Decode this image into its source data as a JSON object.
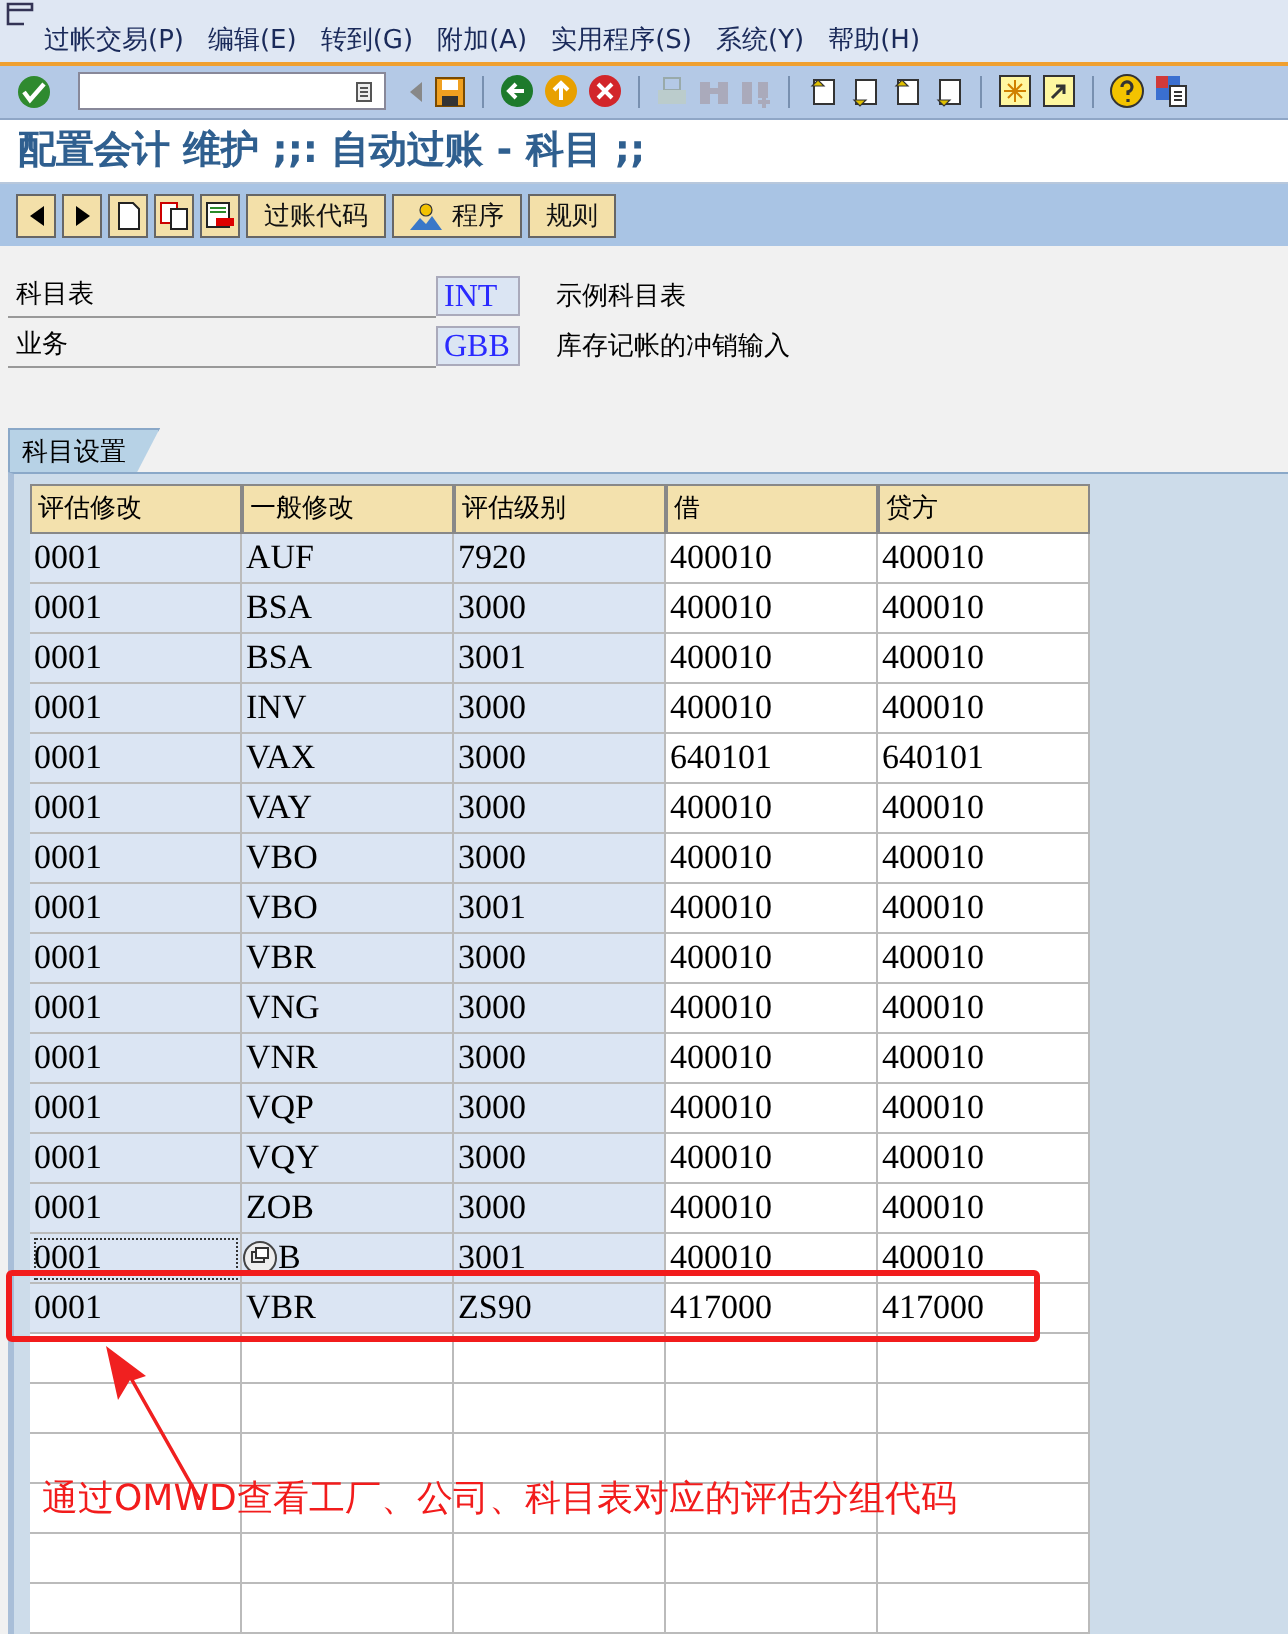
{
  "menu": [
    "过帐交易(P)",
    "编辑(E)",
    "转到(G)",
    "附加(A)",
    "实用程序(S)",
    "系统(Y)",
    "帮助(H)"
  ],
  "title": "配置会计 维护 ;;: 自动过账 - 科目 ;;",
  "app_buttons": [
    {
      "label": "过账代码",
      "kind": "plain"
    },
    {
      "label": "程序",
      "kind": "with_icon"
    },
    {
      "label": "规则",
      "kind": "plain"
    }
  ],
  "fields": [
    {
      "label": "科目表",
      "value": "INT",
      "description": "示例科目表"
    },
    {
      "label": "业务",
      "value": "GBB",
      "description": "库存记帐的冲销输入"
    }
  ],
  "tab": "科目设置",
  "table": {
    "columns": [
      "评估修改",
      "一般修改",
      "评估级别",
      "借",
      "贷方"
    ],
    "rows": [
      {
        "cells": [
          "0001",
          "AUF",
          "7920",
          "400010",
          "400010"
        ],
        "focused": false,
        "highlighted": false
      },
      {
        "cells": [
          "0001",
          "BSA",
          "3000",
          "400010",
          "400010"
        ],
        "focused": false,
        "highlighted": false
      },
      {
        "cells": [
          "0001",
          "BSA",
          "3001",
          "400010",
          "400010"
        ],
        "focused": false,
        "highlighted": false
      },
      {
        "cells": [
          "0001",
          "INV",
          "3000",
          "400010",
          "400010"
        ],
        "focused": false,
        "highlighted": false
      },
      {
        "cells": [
          "0001",
          "VAX",
          "3000",
          "640101",
          "640101"
        ],
        "focused": false,
        "highlighted": false
      },
      {
        "cells": [
          "0001",
          "VAY",
          "3000",
          "400010",
          "400010"
        ],
        "focused": false,
        "highlighted": false
      },
      {
        "cells": [
          "0001",
          "VBO",
          "3000",
          "400010",
          "400010"
        ],
        "focused": false,
        "highlighted": false
      },
      {
        "cells": [
          "0001",
          "VBO",
          "3001",
          "400010",
          "400010"
        ],
        "focused": false,
        "highlighted": false
      },
      {
        "cells": [
          "0001",
          "VBR",
          "3000",
          "400010",
          "400010"
        ],
        "focused": false,
        "highlighted": false
      },
      {
        "cells": [
          "0001",
          "VNG",
          "3000",
          "400010",
          "400010"
        ],
        "focused": false,
        "highlighted": false
      },
      {
        "cells": [
          "0001",
          "VNR",
          "3000",
          "400010",
          "400010"
        ],
        "focused": false,
        "highlighted": false
      },
      {
        "cells": [
          "0001",
          "VQP",
          "3000",
          "400010",
          "400010"
        ],
        "focused": false,
        "highlighted": false
      },
      {
        "cells": [
          "0001",
          "VQY",
          "3000",
          "400010",
          "400010"
        ],
        "focused": false,
        "highlighted": false
      },
      {
        "cells": [
          "0001",
          "ZOB",
          "3000",
          "400010",
          "400010"
        ],
        "focused": false,
        "highlighted": false
      },
      {
        "cells": [
          "0001",
          "B",
          "3001",
          "400010",
          "400010"
        ],
        "focused": true,
        "highlighted": false
      },
      {
        "cells": [
          "0001",
          "VBR",
          "ZS90",
          "417000",
          "417000"
        ],
        "focused": false,
        "highlighted": true
      }
    ]
  },
  "annotation": "通过OMWD查看工厂、公司、科目表对应的评估分组代码"
}
